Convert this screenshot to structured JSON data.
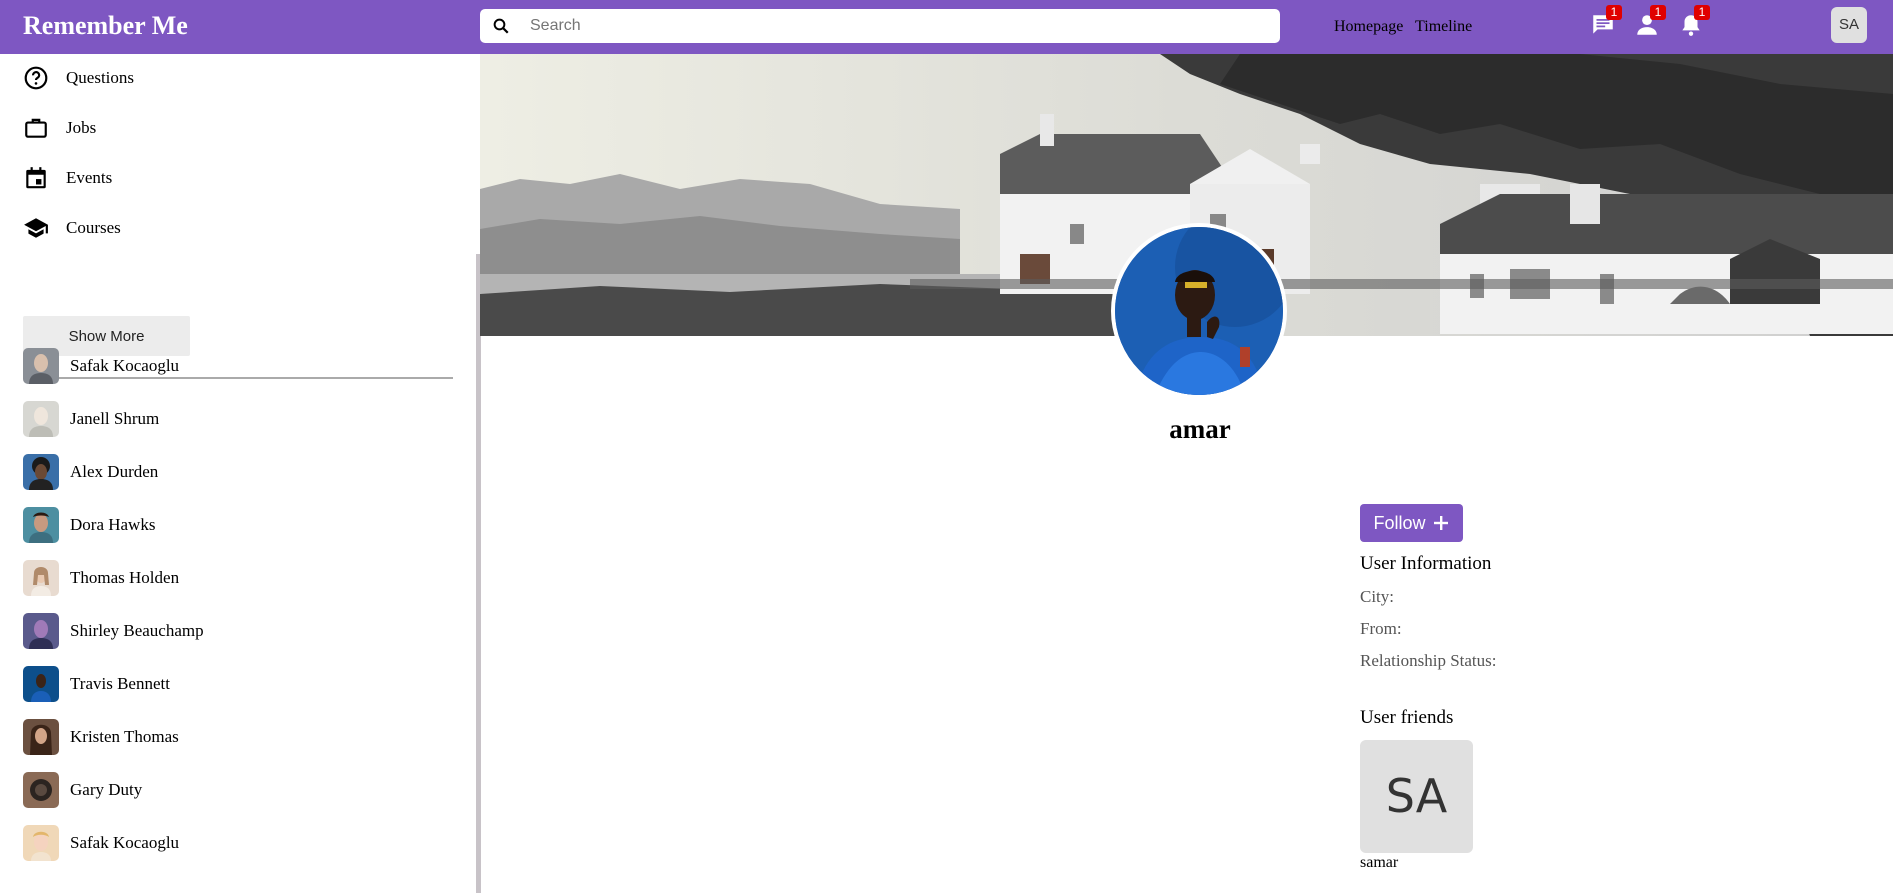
{
  "app": {
    "title": "Remember Me"
  },
  "search": {
    "placeholder": "Search",
    "value": ""
  },
  "nav": {
    "homepage": "Homepage",
    "timeline": "Timeline"
  },
  "notifications": {
    "chat_count": "1",
    "friend_request_count": "1",
    "alert_count": "1"
  },
  "user_avatar": "SA",
  "sidebar": {
    "menu": [
      {
        "label": "Questions",
        "icon": "help-circle-icon"
      },
      {
        "label": "Jobs",
        "icon": "briefcase-icon"
      },
      {
        "label": "Events",
        "icon": "calendar-icon"
      },
      {
        "label": "Courses",
        "icon": "graduation-cap-icon"
      }
    ],
    "show_more": "Show More",
    "friends": [
      {
        "name": "Safak Kocaoglu",
        "color": "#8a8f96"
      },
      {
        "name": "Janell Shrum",
        "color": "#d7d7d2"
      },
      {
        "name": "Alex Durden",
        "color": "#3a6fa8"
      },
      {
        "name": "Dora Hawks",
        "color": "#4d8fa1"
      },
      {
        "name": "Thomas Holden",
        "color": "#e8dbd0"
      },
      {
        "name": "Shirley Beauchamp",
        "color": "#5a5a8c"
      },
      {
        "name": "Travis Bennett",
        "color": "#0d4f8b"
      },
      {
        "name": "Kristen Thomas",
        "color": "#6b5040"
      },
      {
        "name": "Gary Duty",
        "color": "#8a6a55"
      },
      {
        "name": "Safak Kocaoglu",
        "color": "#f0d8b8"
      }
    ]
  },
  "profile": {
    "username": "amar",
    "follow_label": "Follow",
    "info_title": "User Information",
    "city_label": "City:",
    "from_label": "From:",
    "relationship_label": "Relationship Status:",
    "friends_title": "User friends",
    "friends": [
      {
        "initials": "SA",
        "name": "samar"
      }
    ]
  },
  "colors": {
    "brand": "#7e57c2",
    "badge": "#e00000"
  }
}
